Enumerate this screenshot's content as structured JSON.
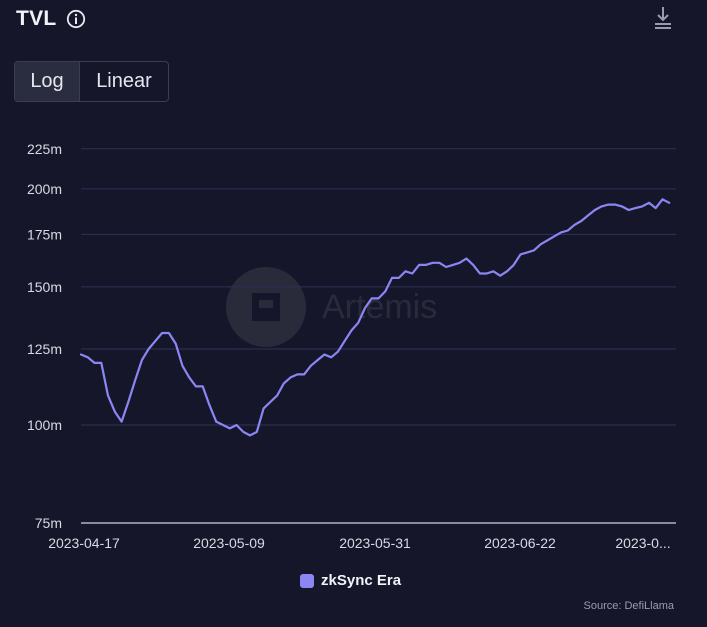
{
  "header": {
    "title": "TVL"
  },
  "toggle": {
    "log_label": "Log",
    "linear_label": "Linear",
    "selected": "Log"
  },
  "source": "Source: DefiLlama",
  "colors": {
    "background": "#15162a",
    "line": "#8b86f4",
    "grid": "#2f3156",
    "axis": "#9a9cae"
  },
  "icons": {
    "info": "info-icon",
    "download": "download-icon"
  },
  "watermark": {
    "text": "Artemis"
  },
  "chart_data": {
    "type": "line",
    "title": "TVL",
    "scale": "log",
    "ylim": [
      75,
      225
    ],
    "ytick_values": [
      75,
      100,
      125,
      150,
      175,
      200,
      225
    ],
    "ytick_labels": [
      "75m",
      "100m",
      "125m",
      "150m",
      "175m",
      "200m",
      "225m"
    ],
    "xtick_labels": [
      "2023-04-17",
      "2023-05-09",
      "2023-05-31",
      "2023-06-22",
      "2023-0..."
    ],
    "xlim": [
      "2023-04-17",
      "2023-07-14"
    ],
    "grid": true,
    "legend_position": "bottom",
    "series": [
      {
        "name": "zkSync Era",
        "color": "#8b86f4",
        "x": [
          "2023-04-17",
          "2023-04-18",
          "2023-04-19",
          "2023-04-20",
          "2023-04-21",
          "2023-04-22",
          "2023-04-23",
          "2023-04-24",
          "2023-04-25",
          "2023-04-26",
          "2023-04-27",
          "2023-04-28",
          "2023-04-29",
          "2023-04-30",
          "2023-05-01",
          "2023-05-02",
          "2023-05-03",
          "2023-05-04",
          "2023-05-05",
          "2023-05-06",
          "2023-05-07",
          "2023-05-08",
          "2023-05-09",
          "2023-05-10",
          "2023-05-11",
          "2023-05-12",
          "2023-05-13",
          "2023-05-14",
          "2023-05-15",
          "2023-05-16",
          "2023-05-17",
          "2023-05-18",
          "2023-05-19",
          "2023-05-20",
          "2023-05-21",
          "2023-05-22",
          "2023-05-23",
          "2023-05-24",
          "2023-05-25",
          "2023-05-26",
          "2023-05-27",
          "2023-05-28",
          "2023-05-29",
          "2023-05-30",
          "2023-05-31",
          "2023-06-01",
          "2023-06-02",
          "2023-06-03",
          "2023-06-04",
          "2023-06-05",
          "2023-06-06",
          "2023-06-07",
          "2023-06-08",
          "2023-06-09",
          "2023-06-10",
          "2023-06-11",
          "2023-06-12",
          "2023-06-13",
          "2023-06-14",
          "2023-06-15",
          "2023-06-16",
          "2023-06-17",
          "2023-06-18",
          "2023-06-19",
          "2023-06-20",
          "2023-06-21",
          "2023-06-22",
          "2023-06-23",
          "2023-06-24",
          "2023-06-25",
          "2023-06-26",
          "2023-06-27",
          "2023-06-28",
          "2023-06-29",
          "2023-06-30",
          "2023-07-01",
          "2023-07-02",
          "2023-07-03",
          "2023-07-04",
          "2023-07-05",
          "2023-07-06",
          "2023-07-07",
          "2023-07-08",
          "2023-07-09",
          "2023-07-10",
          "2023-07-11",
          "2023-07-12",
          "2023-07-13"
        ],
        "values": [
          123,
          122,
          120,
          120,
          109,
          104,
          101,
          107,
          114,
          121,
          125,
          128,
          131,
          131,
          127,
          119,
          115,
          112,
          112,
          106,
          101,
          100,
          99,
          100,
          98,
          97,
          98,
          105,
          107,
          109,
          113,
          115,
          116,
          116,
          119,
          121,
          123,
          122,
          124,
          128,
          132,
          135,
          141,
          145,
          145,
          148,
          154,
          154,
          157,
          156,
          160,
          160,
          161,
          161,
          159,
          160,
          161,
          163,
          160,
          156,
          156,
          157,
          155,
          157,
          160,
          165,
          166,
          167,
          170,
          172,
          174,
          176,
          177,
          180,
          182,
          185,
          188,
          190,
          191,
          191,
          190,
          188,
          189,
          190,
          192,
          189,
          194,
          192
        ]
      }
    ]
  }
}
